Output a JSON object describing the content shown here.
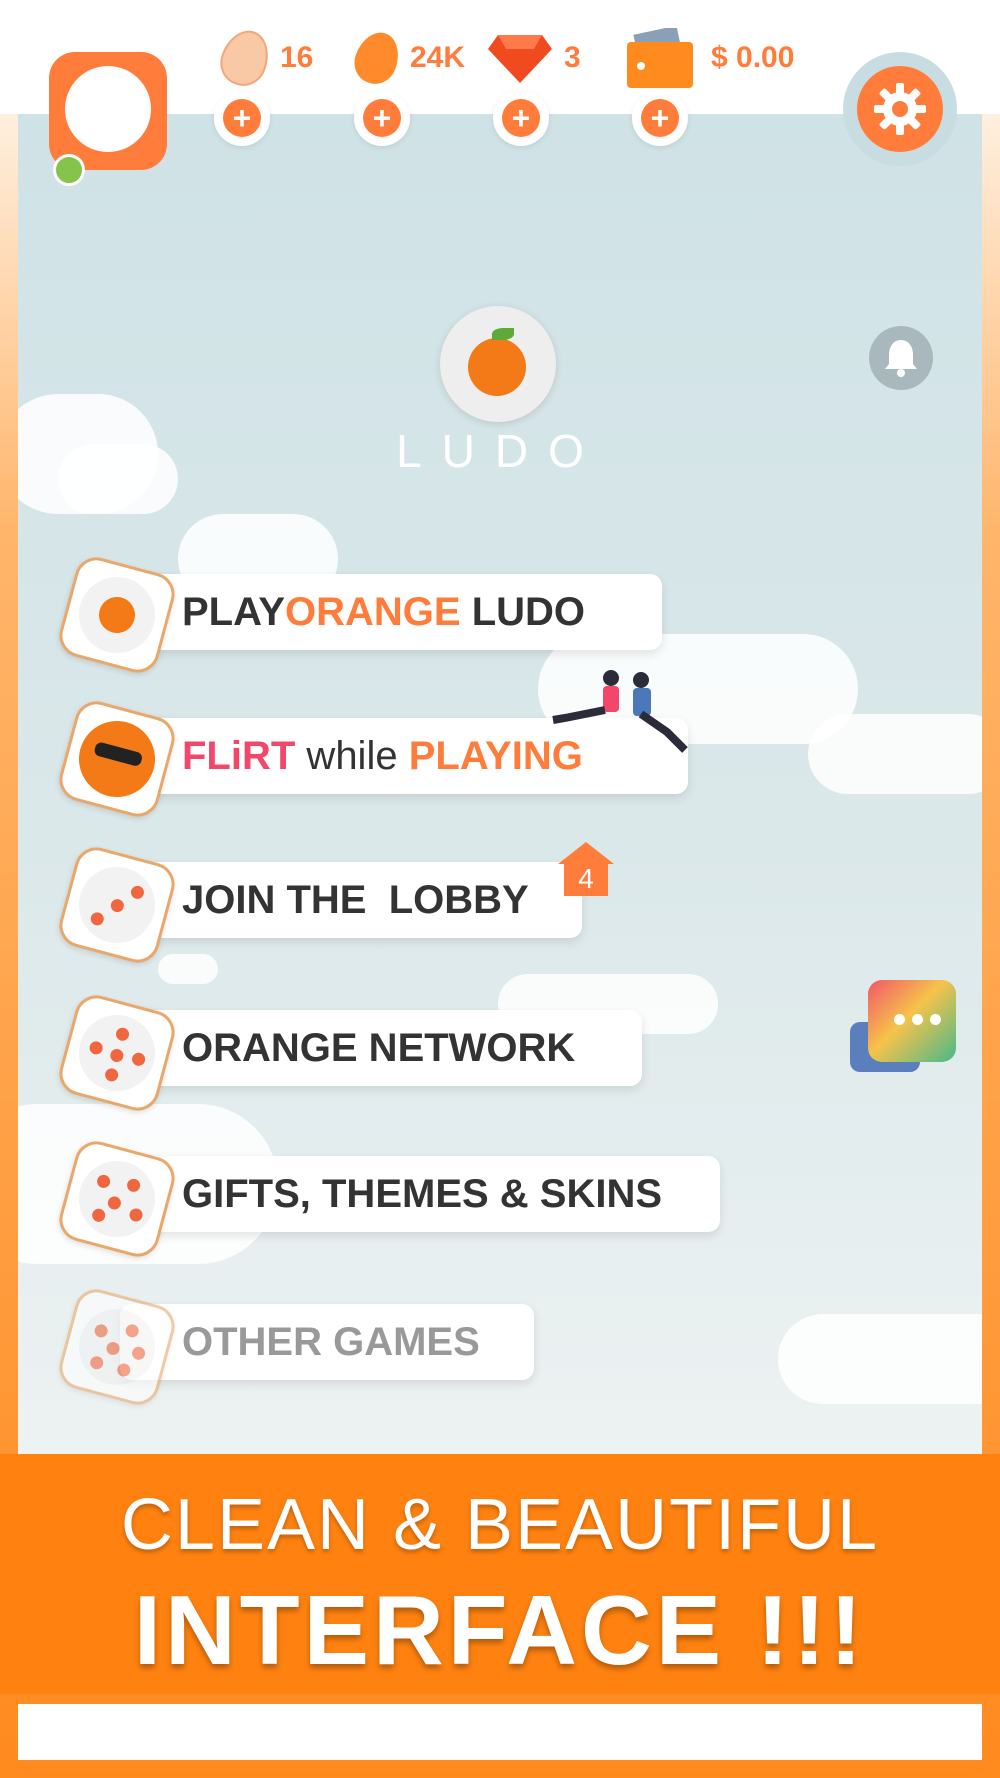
{
  "currencies": [
    {
      "name": "egg-icon",
      "value": "16",
      "color": "#f9c9a5"
    },
    {
      "name": "gold-egg-icon",
      "value": "24K",
      "color": "#ff8a2b"
    },
    {
      "name": "gem-icon",
      "value": "3",
      "color": "#f04a1e"
    },
    {
      "name": "wallet-icon",
      "value": "$ 0.00",
      "color": "#ff8a1e"
    }
  ],
  "header": {
    "add_symbol": "+"
  },
  "logo": {
    "text": "LUDO"
  },
  "menu": {
    "play": {
      "a": "PLAY ",
      "b": "ORANGE",
      "c": " LUDO"
    },
    "flirt": {
      "a": "FLiRT",
      "b": " while ",
      "c": "PLAYING"
    },
    "lobby": {
      "label": "JOIN THE  LOBBY",
      "badge": "4"
    },
    "network": {
      "label": "ORANGE NETWORK"
    },
    "gifts": {
      "label": "GIFTS, THEMES & SKINS"
    },
    "other": {
      "label": "OTHER GAMES"
    }
  },
  "banner": {
    "line1": "CLEAN & BEAUTIFUL",
    "line2": "INTERFACE !!!"
  },
  "colors": {
    "accent": "#ff7c3b",
    "flirt": "#f2466a",
    "banner": "#ff8210"
  }
}
